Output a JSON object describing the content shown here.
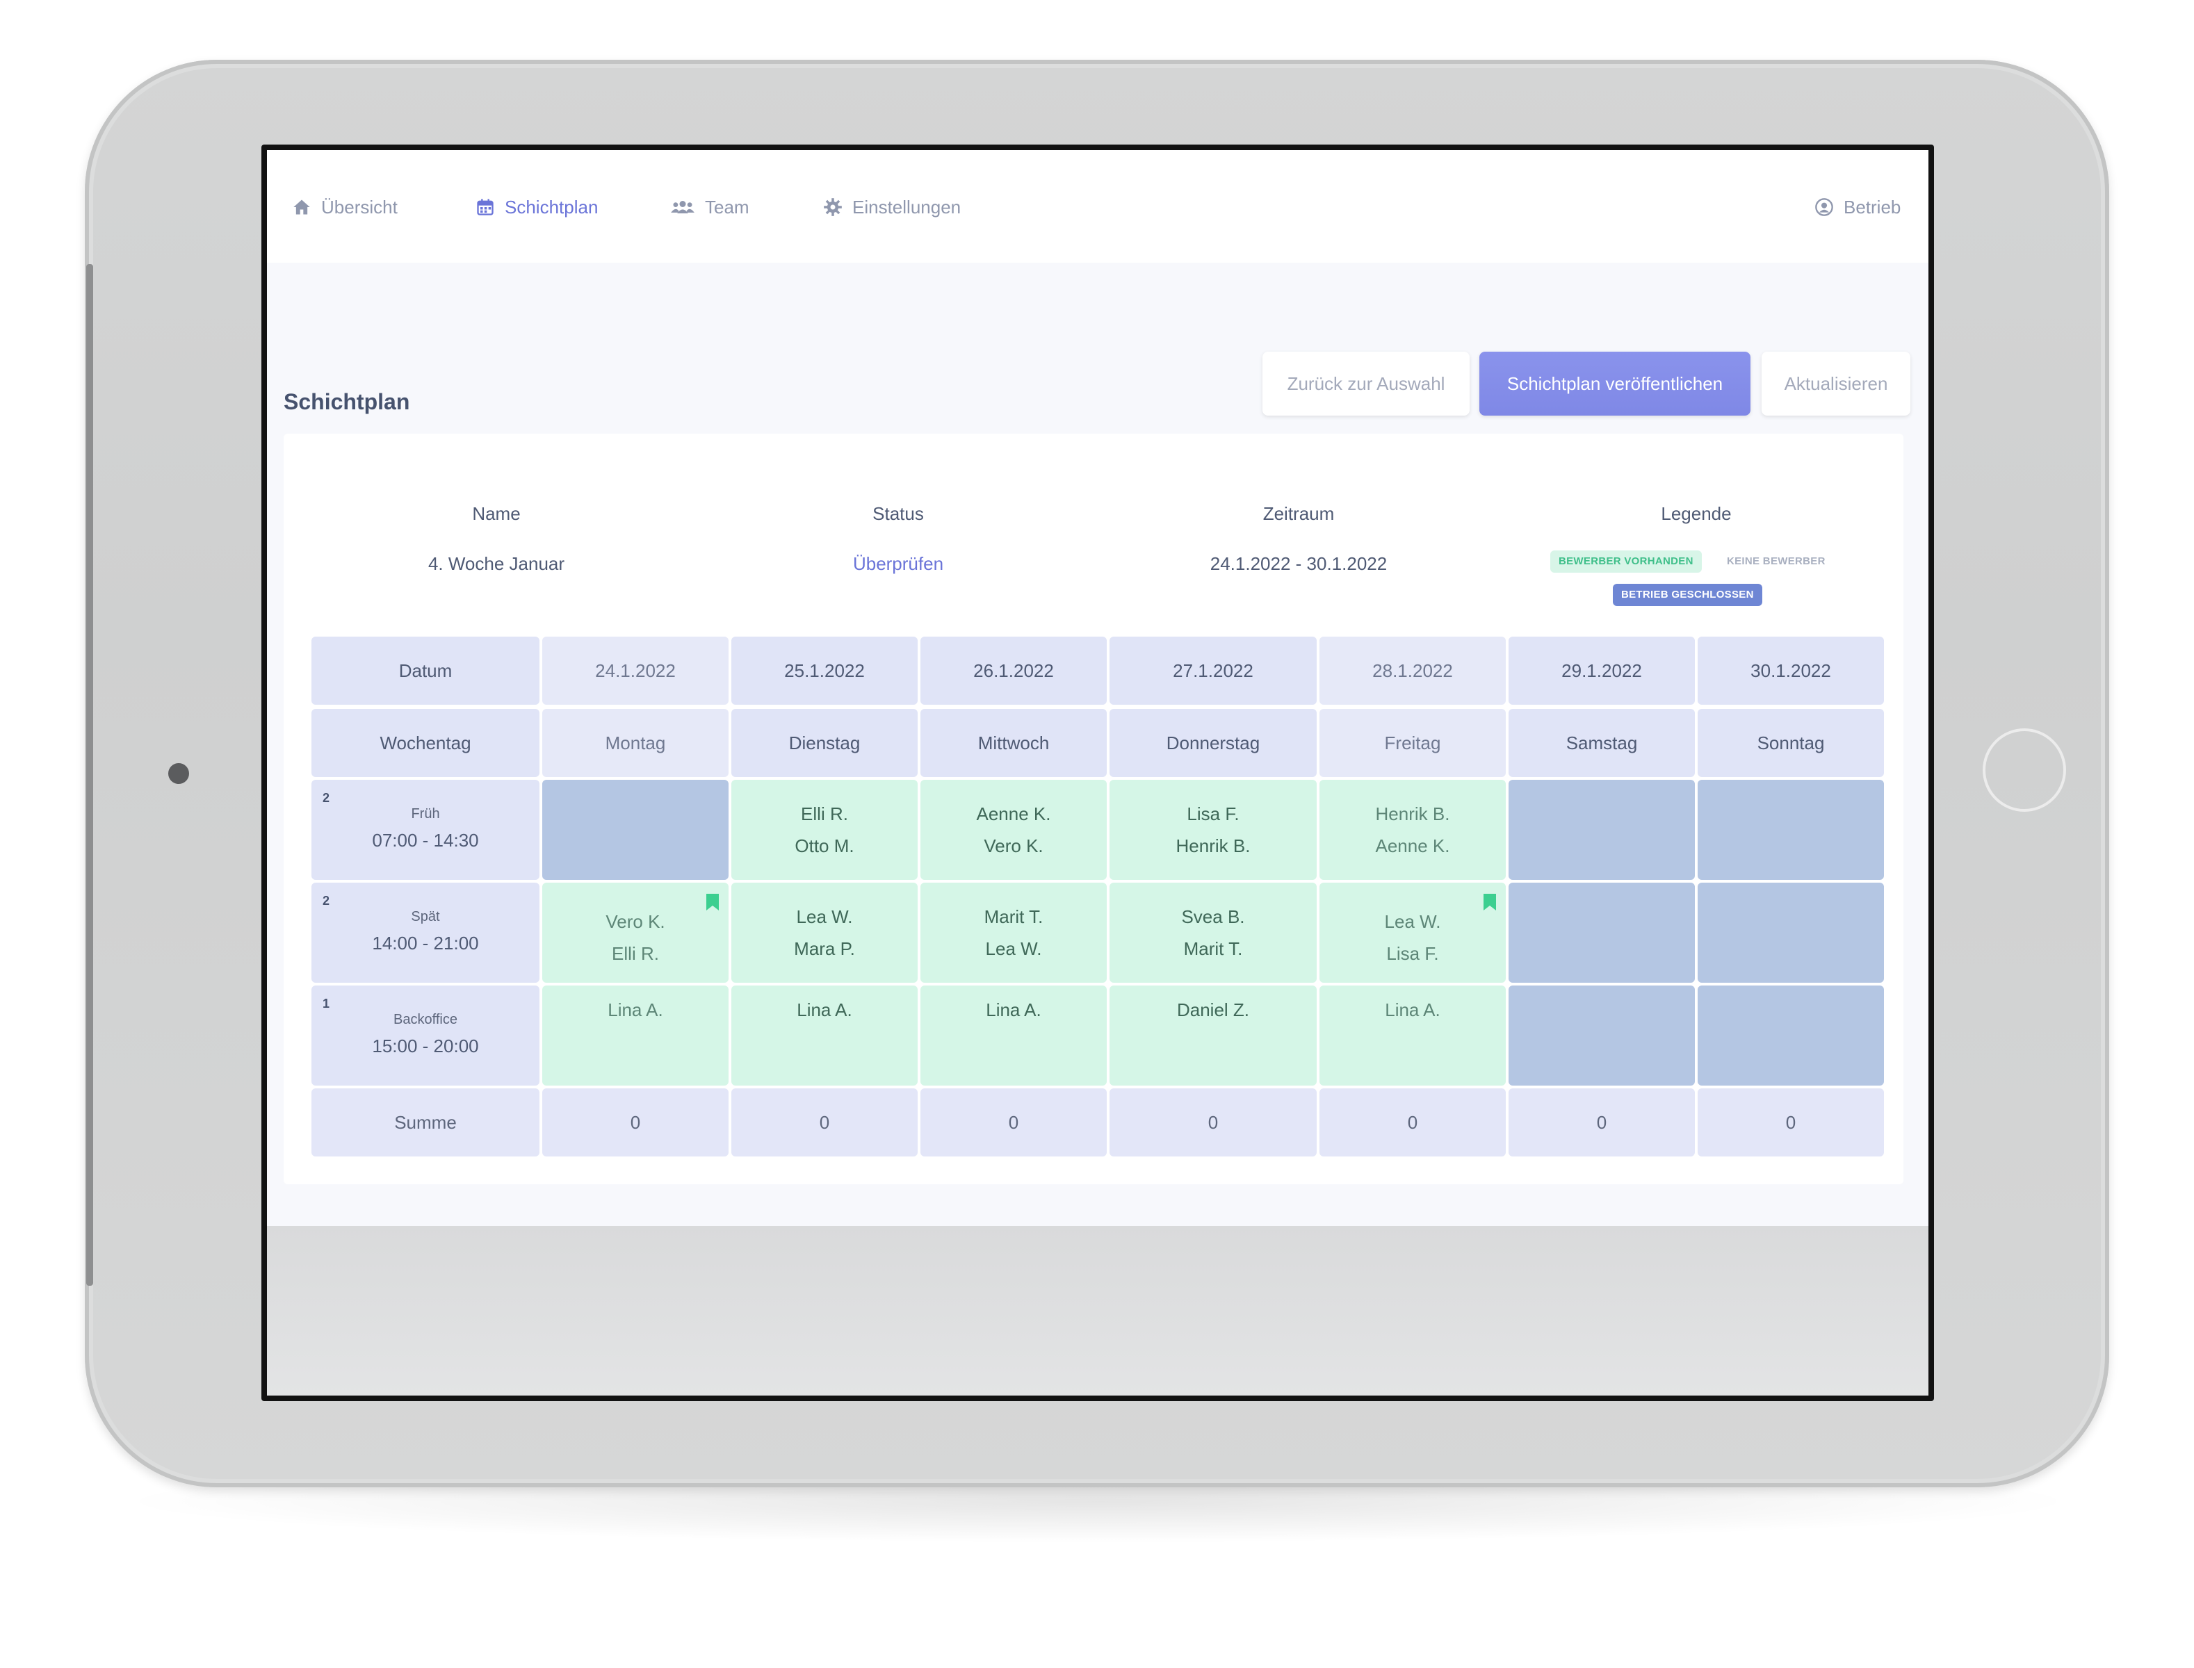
{
  "nav": {
    "items": [
      {
        "label": "Übersicht",
        "icon": "home-icon"
      },
      {
        "label": "Schichtplan",
        "icon": "calendar-icon"
      },
      {
        "label": "Team",
        "icon": "users-icon"
      },
      {
        "label": "Einstellungen",
        "icon": "gear-icon"
      }
    ],
    "account": {
      "label": "Betrieb",
      "icon": "user-circle-icon"
    }
  },
  "header": {
    "title": "Schichtplan",
    "buttons": {
      "back": "Zurück zur Auswahl",
      "publish": "Schichtplan veröffentlichen",
      "refresh": "Aktualisieren"
    }
  },
  "info": {
    "name": {
      "label": "Name",
      "value": "4. Woche Januar"
    },
    "status": {
      "label": "Status",
      "value": "Überprüfen"
    },
    "period": {
      "label": "Zeitraum",
      "value": "24.1.2022 - 30.1.2022"
    },
    "legend": {
      "label": "Legende",
      "items": [
        "BEWERBER VORHANDEN",
        "KEINE BEWERBER",
        "BETRIEB GESCHLOSSEN"
      ]
    }
  },
  "colors": {
    "accent": "#7f88e6",
    "applicants": "#d5f6e7",
    "closed": "#b4c6e3",
    "header": "#e0e4f7"
  },
  "schedule": {
    "row_labels": {
      "date": "Datum",
      "weekday": "Wochentag",
      "sum": "Summe"
    },
    "days": [
      {
        "date": "24.1.2022",
        "weekday": "Montag",
        "sum": "0"
      },
      {
        "date": "25.1.2022",
        "weekday": "Dienstag",
        "sum": "0"
      },
      {
        "date": "26.1.2022",
        "weekday": "Mittwoch",
        "sum": "0"
      },
      {
        "date": "27.1.2022",
        "weekday": "Donnerstag",
        "sum": "0"
      },
      {
        "date": "28.1.2022",
        "weekday": "Freitag",
        "sum": "0"
      },
      {
        "date": "29.1.2022",
        "weekday": "Samstag",
        "sum": "0"
      },
      {
        "date": "30.1.2022",
        "weekday": "Sonntag",
        "sum": "0"
      }
    ],
    "shifts": [
      {
        "count": "2",
        "name": "Früh",
        "time": "07:00 - 14:30",
        "cells": [
          {
            "status": "closed",
            "names": []
          },
          {
            "status": "applicants",
            "names": [
              "Elli R.",
              "Otto M."
            ]
          },
          {
            "status": "applicants",
            "names": [
              "Aenne K.",
              "Vero K."
            ]
          },
          {
            "status": "applicants",
            "names": [
              "Lisa F.",
              "Henrik B."
            ]
          },
          {
            "status": "applicants",
            "names": [
              "Henrik B.",
              "Aenne K."
            ]
          },
          {
            "status": "closed",
            "names": []
          },
          {
            "status": "closed",
            "names": []
          }
        ]
      },
      {
        "count": "2",
        "name": "Spät",
        "time": "14:00 - 21:00",
        "cells": [
          {
            "status": "applicants",
            "names": [
              "Vero K.",
              "Elli R."
            ],
            "bookmarked": true
          },
          {
            "status": "applicants",
            "names": [
              "Lea W.",
              "Mara P."
            ]
          },
          {
            "status": "applicants",
            "names": [
              "Marit T.",
              "Lea W."
            ]
          },
          {
            "status": "applicants",
            "names": [
              "Svea B.",
              "Marit T."
            ]
          },
          {
            "status": "applicants",
            "names": [
              "Lea W.",
              "Lisa F."
            ],
            "bookmarked": true
          },
          {
            "status": "closed",
            "names": []
          },
          {
            "status": "closed",
            "names": []
          }
        ]
      },
      {
        "count": "1",
        "name": "Backoffice",
        "time": "15:00 - 20:00",
        "cells": [
          {
            "status": "applicants",
            "names": [
              "Lina A."
            ]
          },
          {
            "status": "applicants",
            "names": [
              "Lina A."
            ]
          },
          {
            "status": "applicants",
            "names": [
              "Lina A."
            ]
          },
          {
            "status": "applicants",
            "names": [
              "Daniel Z."
            ]
          },
          {
            "status": "applicants",
            "names": [
              "Lina A."
            ]
          },
          {
            "status": "closed",
            "names": []
          },
          {
            "status": "closed",
            "names": []
          }
        ]
      }
    ]
  }
}
